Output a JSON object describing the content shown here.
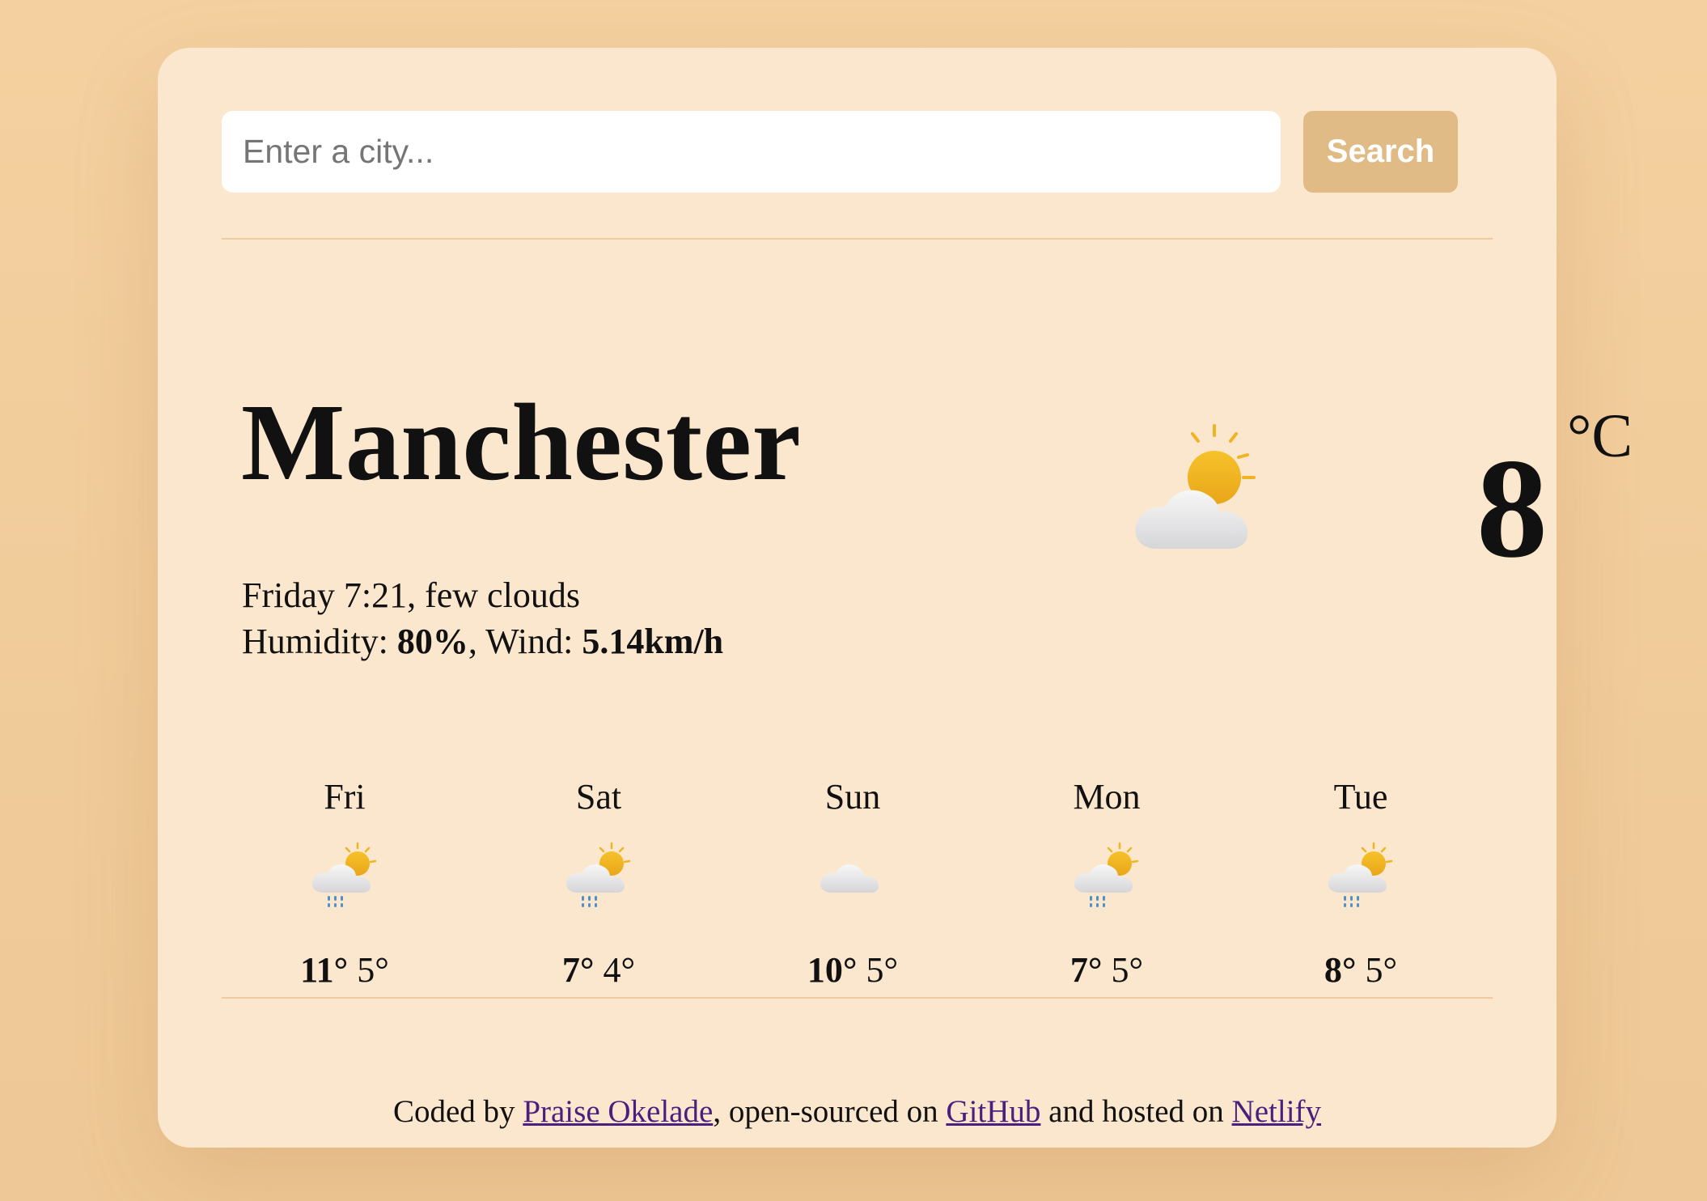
{
  "search": {
    "placeholder": "Enter a city...",
    "button_label": "Search"
  },
  "current": {
    "city": "Manchester",
    "datetime_desc": "Friday 7:21, few clouds",
    "humidity_label": "Humidity: ",
    "humidity_value": "80%",
    "wind_label": ", Wind: ",
    "wind_value": "5.14km/h",
    "icon": "few-clouds-day-icon",
    "temperature": "8",
    "unit": "°C"
  },
  "forecast": [
    {
      "day": "Fri",
      "max": "11°",
      "min": "5°",
      "icon": "rain-sun-icon"
    },
    {
      "day": "Sat",
      "max": "7°",
      "min": "4°",
      "icon": "rain-sun-icon"
    },
    {
      "day": "Sun",
      "max": "10°",
      "min": "5°",
      "icon": "cloud-icon"
    },
    {
      "day": "Mon",
      "max": "7°",
      "min": "5°",
      "icon": "rain-sun-icon"
    },
    {
      "day": "Tue",
      "max": "8°",
      "min": "5°",
      "icon": "rain-sun-icon"
    }
  ],
  "footer": {
    "prefix": "Coded by ",
    "author_link": "Praise Okelade",
    "middle": ", open-sourced on ",
    "github_link": "GitHub",
    "between": " and hosted on ",
    "netlify_link": "Netlify"
  },
  "colors": {
    "page_background": "#f4d0a0",
    "card_background": "#fbe7cd",
    "button_background": "#e0bb86",
    "link": "#4b1f7d",
    "sun": "#f0b422"
  }
}
